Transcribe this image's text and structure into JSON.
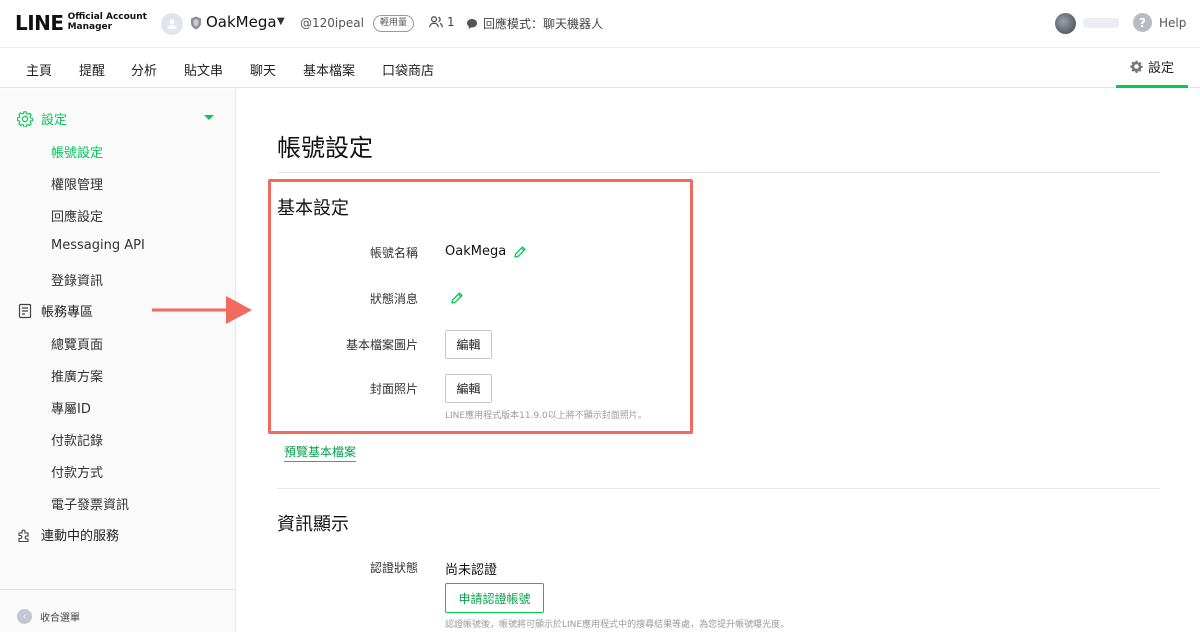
{
  "header": {
    "logo_main": "LINE",
    "logo_sub_1": "Official Account",
    "logo_sub_2": "Manager",
    "account_name": "OakMega",
    "account_id": "@120ipeal",
    "usage_badge": "輕用量",
    "friend_count": "1",
    "reply_mode": "回應模式：聊天機器人",
    "help": "Help"
  },
  "nav": {
    "tabs": [
      "主頁",
      "提醒",
      "分析",
      "貼文串",
      "聊天",
      "基本檔案",
      "口袋商店"
    ],
    "settings": "設定"
  },
  "sidebar": {
    "settings_group": "設定",
    "settings_items": [
      "帳號設定",
      "權限管理",
      "回應設定",
      "Messaging API",
      "登錄資訊"
    ],
    "billing_group": "帳務專區",
    "billing_items": [
      "總覽頁面",
      "推廣方案",
      "專屬ID",
      "付款記錄",
      "付款方式",
      "電子發票資訊"
    ],
    "linked_services": "連動中的服務",
    "collapse": "收合選單"
  },
  "main": {
    "title": "帳號設定",
    "basic": {
      "title": "基本設定",
      "account_name_label": "帳號名稱",
      "account_name_value": "OakMega",
      "status_label": "狀態消息",
      "profile_image_label": "基本檔案圖片",
      "edit_label": "編輯",
      "cover_label": "封面照片",
      "cover_note": "LINE應用程式版本11.9.0以上將不顯示封面照片。"
    },
    "preview_link": "預覽基本檔案",
    "info": {
      "title": "資訊顯示",
      "cert_label": "認證狀態",
      "cert_value": "尚未認證",
      "apply_button": "申請認證帳號",
      "cert_note": "認證帳號後，帳號將可顯示於LINE應用程式中的搜尋結果等處，為您提升帳號曝光度。"
    }
  },
  "colors": {
    "brand_green": "#06c755",
    "annotation": "#f06a5e"
  }
}
